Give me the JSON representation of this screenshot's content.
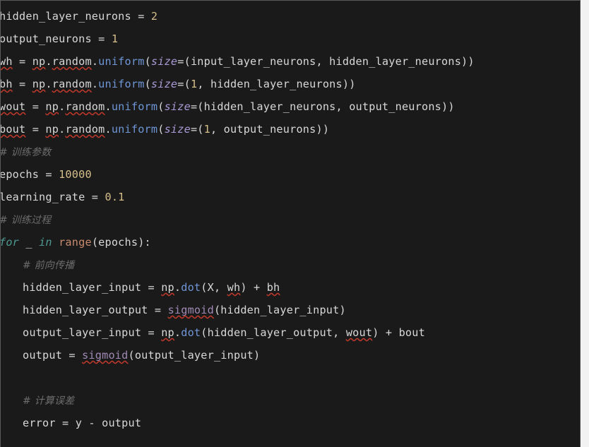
{
  "editor": {
    "theme": "dark",
    "language": "python",
    "background_color": "#1a1a1a",
    "page_background_color": "#f2f2f2",
    "default_text_color": "#d6d6d6",
    "colors": {
      "number": "#d6bf8a",
      "builtin_function": "#6f96d6",
      "call": "#c98a6d",
      "keyword": "#4e9a92",
      "parameter": "#a99ad6",
      "user_function": "#a08ab5",
      "comment": "#6d6d6d",
      "spellcheck_underline": "#c0392b"
    }
  },
  "code": {
    "lines": [
      {
        "id": "line-1",
        "indent": 0,
        "tokens": [
          {
            "t": "hidden_layer_neurons = ",
            "c": "plain"
          },
          {
            "t": "2",
            "c": "num"
          }
        ]
      },
      {
        "id": "line-2",
        "indent": 0,
        "tokens": [
          {
            "t": "output_neurons = ",
            "c": "plain"
          },
          {
            "t": "1",
            "c": "num"
          }
        ]
      },
      {
        "id": "line-3",
        "indent": 0,
        "tokens": [
          {
            "t": "wh",
            "c": "plain",
            "sq": true
          },
          {
            "t": " = ",
            "c": "plain"
          },
          {
            "t": "np",
            "c": "plain",
            "sq": true
          },
          {
            "t": ".",
            "c": "plain"
          },
          {
            "t": "random",
            "c": "plain",
            "sq": true
          },
          {
            "t": ".",
            "c": "plain"
          },
          {
            "t": "uniform",
            "c": "func"
          },
          {
            "t": "(",
            "c": "punc"
          },
          {
            "t": "size",
            "c": "param"
          },
          {
            "t": "=(input_layer_neurons, hidden_layer_neurons))",
            "c": "plain"
          }
        ]
      },
      {
        "id": "line-4",
        "indent": 0,
        "tokens": [
          {
            "t": "bh",
            "c": "plain",
            "sq": true
          },
          {
            "t": " = ",
            "c": "plain"
          },
          {
            "t": "np",
            "c": "plain",
            "sq": true
          },
          {
            "t": ".",
            "c": "plain"
          },
          {
            "t": "random",
            "c": "plain",
            "sq": true
          },
          {
            "t": ".",
            "c": "plain"
          },
          {
            "t": "uniform",
            "c": "func"
          },
          {
            "t": "(",
            "c": "punc"
          },
          {
            "t": "size",
            "c": "param"
          },
          {
            "t": "=(",
            "c": "plain"
          },
          {
            "t": "1",
            "c": "num"
          },
          {
            "t": ", hidden_layer_neurons))",
            "c": "plain"
          }
        ]
      },
      {
        "id": "line-5",
        "indent": 0,
        "tokens": [
          {
            "t": "wout",
            "c": "plain",
            "sq": true
          },
          {
            "t": " = ",
            "c": "plain"
          },
          {
            "t": "np",
            "c": "plain",
            "sq": true
          },
          {
            "t": ".",
            "c": "plain"
          },
          {
            "t": "random",
            "c": "plain",
            "sq": true
          },
          {
            "t": ".",
            "c": "plain"
          },
          {
            "t": "uniform",
            "c": "func"
          },
          {
            "t": "(",
            "c": "punc"
          },
          {
            "t": "size",
            "c": "param"
          },
          {
            "t": "=(hidden_layer_neurons, output_neurons))",
            "c": "plain"
          }
        ]
      },
      {
        "id": "line-6",
        "indent": 0,
        "tokens": [
          {
            "t": "bout",
            "c": "plain",
            "sq": true
          },
          {
            "t": " = ",
            "c": "plain"
          },
          {
            "t": "np",
            "c": "plain",
            "sq": true
          },
          {
            "t": ".",
            "c": "plain"
          },
          {
            "t": "random",
            "c": "plain",
            "sq": true
          },
          {
            "t": ".",
            "c": "plain"
          },
          {
            "t": "uniform",
            "c": "func"
          },
          {
            "t": "(",
            "c": "punc"
          },
          {
            "t": "size",
            "c": "param"
          },
          {
            "t": "=(",
            "c": "plain"
          },
          {
            "t": "1",
            "c": "num"
          },
          {
            "t": ", output_neurons))",
            "c": "plain"
          }
        ]
      },
      {
        "id": "line-7",
        "indent": 0,
        "tokens": [
          {
            "t": "# 训练参数",
            "c": "comment"
          }
        ]
      },
      {
        "id": "line-8",
        "indent": 0,
        "tokens": [
          {
            "t": "epochs = ",
            "c": "plain"
          },
          {
            "t": "10000",
            "c": "num"
          }
        ]
      },
      {
        "id": "line-9",
        "indent": 0,
        "tokens": [
          {
            "t": "learning_rate = ",
            "c": "plain"
          },
          {
            "t": "0.1",
            "c": "num"
          }
        ]
      },
      {
        "id": "line-10",
        "indent": 0,
        "tokens": [
          {
            "t": "# 训练过程",
            "c": "comment"
          }
        ]
      },
      {
        "id": "line-11",
        "indent": 0,
        "tokens": [
          {
            "t": "for",
            "c": "kw"
          },
          {
            "t": " _ ",
            "c": "plain"
          },
          {
            "t": "in",
            "c": "kw"
          },
          {
            "t": " ",
            "c": "plain"
          },
          {
            "t": "range",
            "c": "call"
          },
          {
            "t": "(epochs):",
            "c": "plain"
          }
        ]
      },
      {
        "id": "line-12",
        "indent": 1,
        "tokens": [
          {
            "t": "# 前向传播",
            "c": "comment"
          }
        ]
      },
      {
        "id": "line-13",
        "indent": 1,
        "tokens": [
          {
            "t": "hidden_layer_input = ",
            "c": "plain"
          },
          {
            "t": "np",
            "c": "plain",
            "sq": true
          },
          {
            "t": ".",
            "c": "plain"
          },
          {
            "t": "dot",
            "c": "func"
          },
          {
            "t": "(X, ",
            "c": "plain"
          },
          {
            "t": "wh",
            "c": "plain",
            "sq": true
          },
          {
            "t": ") + ",
            "c": "plain"
          },
          {
            "t": "bh",
            "c": "plain",
            "sq": true
          }
        ]
      },
      {
        "id": "line-14",
        "indent": 1,
        "tokens": [
          {
            "t": "hidden_layer_output = ",
            "c": "plain"
          },
          {
            "t": "sigmoid",
            "c": "user",
            "sq": true
          },
          {
            "t": "(hidden_layer_input)",
            "c": "plain"
          }
        ]
      },
      {
        "id": "line-15",
        "indent": 1,
        "tokens": [
          {
            "t": "output_layer_input = ",
            "c": "plain"
          },
          {
            "t": "np",
            "c": "plain",
            "sq": true
          },
          {
            "t": ".",
            "c": "plain"
          },
          {
            "t": "dot",
            "c": "func"
          },
          {
            "t": "(hidden_layer_output, ",
            "c": "plain"
          },
          {
            "t": "wout",
            "c": "plain",
            "sq": true
          },
          {
            "t": ") + bout",
            "c": "plain"
          }
        ]
      },
      {
        "id": "line-16",
        "indent": 1,
        "tokens": [
          {
            "t": "output = ",
            "c": "plain"
          },
          {
            "t": "sigmoid",
            "c": "user",
            "sq": true
          },
          {
            "t": "(output_layer_input)",
            "c": "plain"
          }
        ]
      },
      {
        "id": "line-17",
        "indent": 1,
        "tokens": []
      },
      {
        "id": "line-18",
        "indent": 1,
        "tokens": [
          {
            "t": "# 计算误差",
            "c": "comment"
          }
        ]
      },
      {
        "id": "line-19",
        "indent": 1,
        "tokens": [
          {
            "t": "error = y - output",
            "c": "plain"
          }
        ]
      }
    ]
  }
}
